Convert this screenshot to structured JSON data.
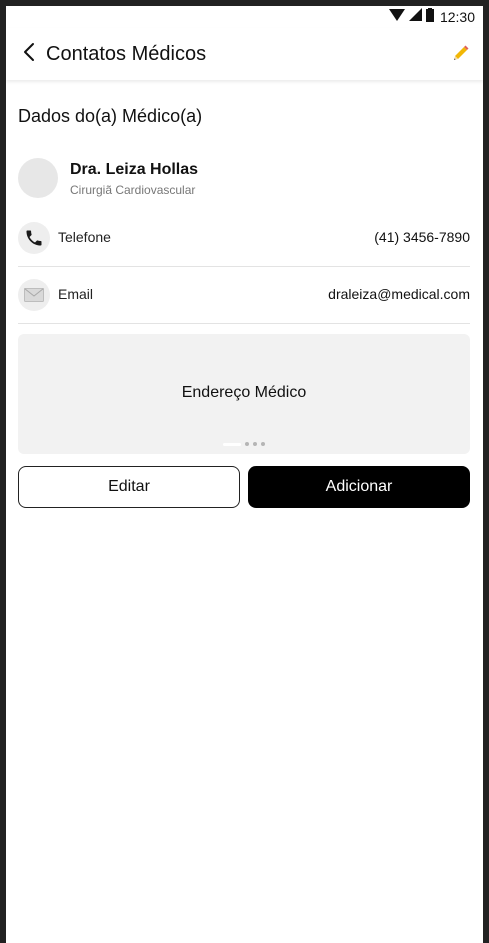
{
  "status_bar": {
    "time": "12:30",
    "icons": [
      "wifi-icon",
      "signal-icon",
      "battery-icon"
    ]
  },
  "app_bar": {
    "title": "Contatos Médicos",
    "back_icon": "back-arrow-icon",
    "edit_icon": "pencil-icon"
  },
  "section": {
    "title": "Dados do(a) Médico(a)"
  },
  "doctor": {
    "name": "Dra. Leiza Hollas",
    "specialty": "Cirurgiã Cardiovascular"
  },
  "contacts": [
    {
      "icon": "phone-icon",
      "label": "Telefone",
      "value": "(41) 3456-7890"
    },
    {
      "icon": "mail-icon",
      "label": "Email",
      "value": "draleiza@medical.com"
    }
  ],
  "address_card": {
    "label": "Endereço Médico",
    "pages": 4,
    "current_page": 1
  },
  "actions": {
    "edit_label": "Editar",
    "add_label": "Adicionar"
  },
  "colors": {
    "primary": "#000000",
    "card_bg": "#f2f2f2",
    "avatar_bg": "#e7e7e7",
    "frame": "#222222"
  }
}
